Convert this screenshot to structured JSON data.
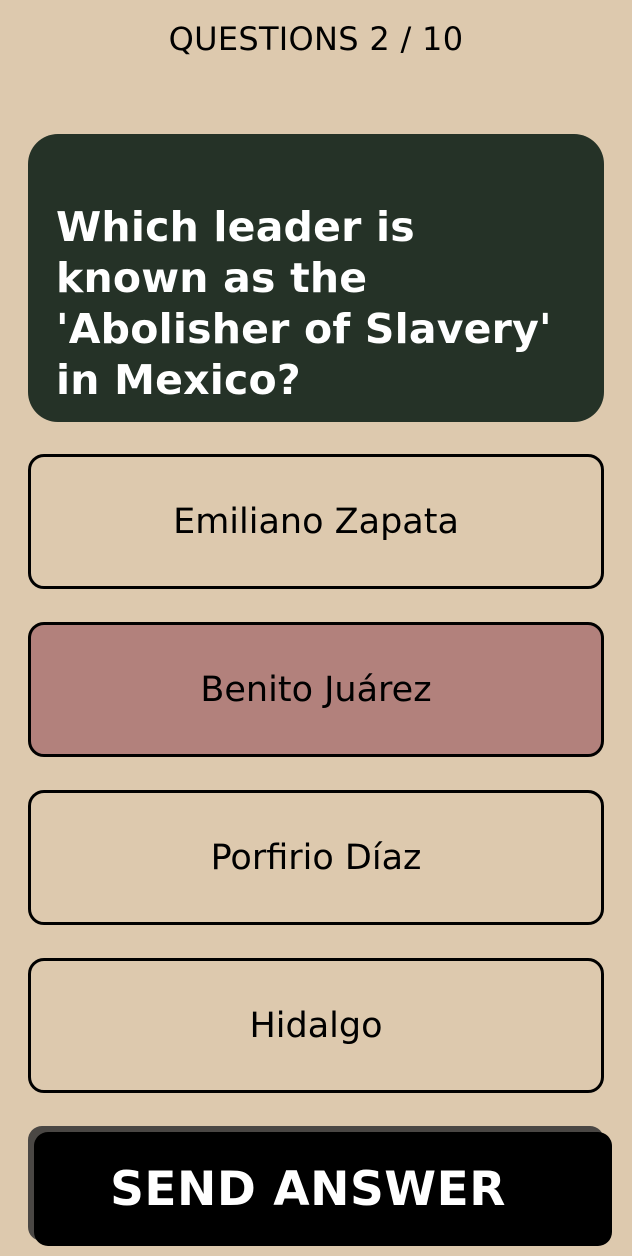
{
  "header": {
    "progress_text": "QUESTIONS 2 / 10"
  },
  "question": {
    "text": "Which leader is known as the 'Abolisher of Slavery' in Mexico?"
  },
  "options": [
    {
      "label": "Emiliano Zapata",
      "selected": false
    },
    {
      "label": "Benito Juárez",
      "selected": true
    },
    {
      "label": "Porfirio Díaz",
      "selected": false
    },
    {
      "label": "Hidalgo",
      "selected": false
    }
  ],
  "actions": {
    "send_label": "SEND ANSWER"
  },
  "colors": {
    "background": "#ddc9ae",
    "question_card": "#253227",
    "selected_option": "#b2817c",
    "button": "#000000"
  }
}
